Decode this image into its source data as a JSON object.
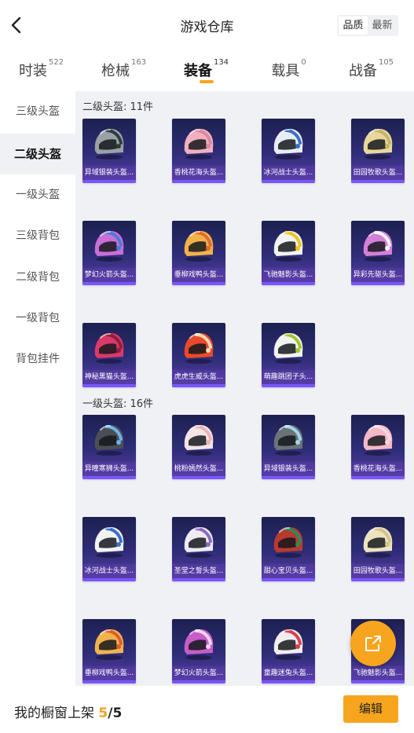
{
  "header": {
    "title": "游戏仓库",
    "sort_quality": "品质",
    "sort_latest": "最新"
  },
  "tabs": [
    {
      "label": "时装",
      "count": "522"
    },
    {
      "label": "枪械",
      "count": "163"
    },
    {
      "label": "装备",
      "count": "134"
    },
    {
      "label": "载具",
      "count": "0"
    },
    {
      "label": "战备",
      "count": "105"
    }
  ],
  "sidebar": [
    "三级头盔",
    "二级头盔",
    "一级头盔",
    "三级背包",
    "二级背包",
    "一级背包",
    "背包挂件"
  ],
  "sections": [
    {
      "title": "二级头盔: 11件",
      "items": [
        {
          "name": "异域银装头盔...",
          "color": "#9aa2a8",
          "accent": "#2f3b3f"
        },
        {
          "name": "香桃花海头盔...",
          "color": "#f1b0bf",
          "accent": "#d98aa0"
        },
        {
          "name": "冰河战士头盔...",
          "color": "#e8eef5",
          "accent": "#3b6fc9"
        },
        {
          "name": "田园牧歌头盔...",
          "color": "#e7d79b",
          "accent": "#c7b46a"
        },
        {
          "name": "梦幻火箭头盔...",
          "color": "#c86fd8",
          "accent": "#4a7bd8"
        },
        {
          "name": "垂柳戏鸭头盔...",
          "color": "#f2b24a",
          "accent": "#e36b2f"
        },
        {
          "name": "飞驰魅影头盔...",
          "color": "#f2f2f2",
          "accent": "#f0c419"
        },
        {
          "name": "异彩先驱头盔...",
          "color": "#d580d8",
          "accent": "#f6f6f6"
        },
        {
          "name": "神秘黑猫头盔...",
          "color": "#d93a6a",
          "accent": "#8f1e3f"
        },
        {
          "name": "虎虎生威头盔...",
          "color": "#e94a2c",
          "accent": "#f4d7b0"
        },
        {
          "name": "萌趣跳团子头...",
          "color": "#f2f2f2",
          "accent": "#9cc828"
        }
      ]
    },
    {
      "title": "一级头盔: 16件",
      "items": [
        {
          "name": "异瞳寒狮头盔...",
          "color": "#4a4f55",
          "accent": "#6fb2e8"
        },
        {
          "name": "桃粉嫣然头盔...",
          "color": "#f4e4e4",
          "accent": "#e9b4b4"
        },
        {
          "name": "异域银装头盔...",
          "color": "#6b7278",
          "accent": "#9fd6e8"
        },
        {
          "name": "香桃花海头盔...",
          "color": "#f4b9c6",
          "accent": "#f7d7df"
        },
        {
          "name": "冰河战士头盔...",
          "color": "#f2f2f4",
          "accent": "#3b6fc9"
        },
        {
          "name": "圣堂之誓头盔...",
          "color": "#eeeaf2",
          "accent": "#8a6bc1"
        },
        {
          "name": "甜心宝贝头盔...",
          "color": "#b83a2e",
          "accent": "#2f8a5a"
        },
        {
          "name": "田园牧歌头盔...",
          "color": "#ece3bf",
          "accent": "#d2c38a"
        },
        {
          "name": "垂柳戏鸭头盔...",
          "color": "#f1b34f",
          "accent": "#e25a2a"
        },
        {
          "name": "梦幻火箭头盔...",
          "color": "#c85dc8",
          "accent": "#f0d6f0"
        },
        {
          "name": "童趣迷兔头盔...",
          "color": "#f2eef0",
          "accent": "#d9404a"
        },
        {
          "name": "飞驰魅影头盔...",
          "color": "#f2f2f2",
          "accent": "#f0c419"
        }
      ]
    }
  ],
  "bottom": {
    "showcase_label": "我的橱窗上架",
    "showcase_count": "5",
    "showcase_total": "/5",
    "edit_label": "编辑"
  },
  "colors": {
    "accent": "#f7a51e",
    "card_bg": "#2f2d78"
  }
}
